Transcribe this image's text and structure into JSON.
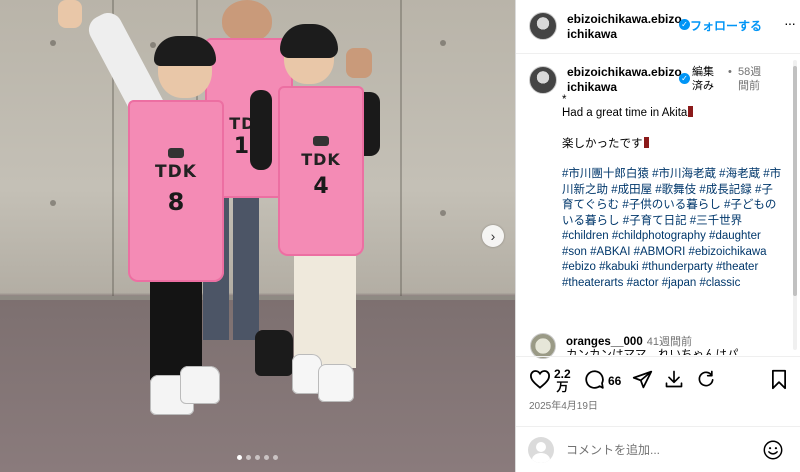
{
  "post": {
    "image_alt": "",
    "jerseys": [
      {
        "brand": "TDK",
        "number": "8"
      },
      {
        "brand": "TDK",
        "number": "13"
      },
      {
        "brand": "TDK",
        "number": "4"
      }
    ],
    "carousel": {
      "count": 5,
      "active_index": 0
    }
  },
  "header": {
    "username_line1": "ebizoichikawa.ebizo",
    "username_line2": "ichikawa",
    "verified_glyph": "✓",
    "follow_label": "フォローする",
    "more_glyph": "···"
  },
  "caption": {
    "username_line1": "ebizoichikawa.ebizo",
    "username_line2": "ichikawa",
    "bullet": "•",
    "edited_line1": "編集",
    "edited_line2": "済み",
    "time_line1": "58週",
    "time_line2": "間前",
    "marker": "*",
    "line1": "Had a great time in Akita",
    "line2": "楽しかったです",
    "hashtags": "#市川團十郎白猿 #市川海老蔵 #海老蔵 #市川新之助 #成田屋 #歌舞伎 #成長記録 #子育てぐらむ #子供のいる暮らし #子どものいる暮らし #子育て日記 #三千世界 #children #childphotography #daughter #son #ABKAI #ABMORI #ebizoichikawa #ebizo #kabuki #thunderparty #theater #theaterarts #actor #japan #classic"
  },
  "reply": {
    "username": "oranges__000",
    "time": "41週間前",
    "text": "カンカンはママ　れいちゃんはパ"
  },
  "actions": {
    "likes_line1": "2.2",
    "likes_line2": "万",
    "comments": "66",
    "date": "2025年4月19日"
  },
  "comment_box": {
    "placeholder": "コメントを追加..."
  },
  "colors": {
    "accent": "#0095f6",
    "hashtag": "#00376b",
    "jersey_pink": "#f48bb5",
    "muted_text": "#737373"
  },
  "icons": [
    "heart-icon",
    "comment-icon",
    "share-icon",
    "repost-icon",
    "bookmark-icon",
    "emoji-icon",
    "chevron-right-icon",
    "more-icon",
    "verified-icon"
  ]
}
